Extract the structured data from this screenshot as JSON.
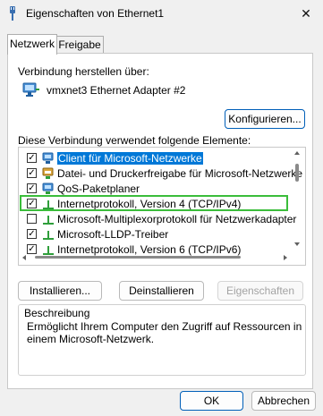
{
  "window": {
    "title": "Eigenschaften von Ethernet1",
    "close_icon": "close-icon"
  },
  "tabs": [
    {
      "label": "Netzwerk"
    },
    {
      "label": "Freigabe"
    }
  ],
  "connect_using": {
    "label": "Verbindung herstellen über:",
    "adapter": "vmxnet3 Ethernet Adapter #2",
    "configure_button": "Konfigurieren..."
  },
  "items_label": "Diese Verbindung verwendet folgende Elemente:",
  "items": [
    {
      "label": "Client für Microsoft-Netzwerke",
      "checked": true,
      "icon": "network-client-icon",
      "selected": true
    },
    {
      "label": "Datei- und Druckerfreigabe für Microsoft-Netzwerke",
      "checked": true,
      "icon": "file-printer-sharing-icon"
    },
    {
      "label": "QoS-Paketplaner",
      "checked": true,
      "icon": "network-service-icon"
    },
    {
      "label": "Internetprotokoll, Version 4 (TCP/IPv4)",
      "checked": true,
      "icon": "protocol-icon"
    },
    {
      "label": "Microsoft-Multiplexorprotokoll für Netzwerkadapter",
      "checked": false,
      "icon": "protocol-icon"
    },
    {
      "label": "Microsoft-LLDP-Treiber",
      "checked": true,
      "icon": "protocol-icon"
    },
    {
      "label": "Internetprotokoll, Version 6 (TCP/IPv6)",
      "checked": true,
      "icon": "protocol-icon"
    }
  ],
  "buttons": {
    "install": "Installieren...",
    "uninstall": "Deinstallieren",
    "properties": "Eigenschaften",
    "ok": "OK",
    "cancel": "Abbrechen"
  },
  "description": {
    "title": "Beschreibung",
    "text_line1": "Ermöglicht Ihrem Computer den Zugriff auf Ressourcen in",
    "text_line2": "einem Microsoft-Netzwerk."
  },
  "colors": {
    "selection": "#0078d7",
    "highlight_box": "#3bbd3b",
    "primary_border": "#005fb8"
  }
}
